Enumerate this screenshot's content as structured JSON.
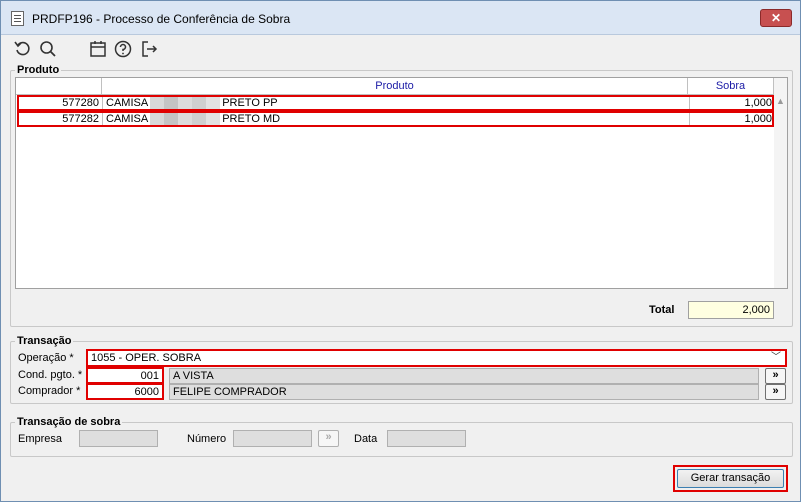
{
  "window": {
    "title": "PRDFP196 - Processo de Conferência de Sobra",
    "close_label": "✕"
  },
  "toolbar": {
    "icons": [
      "refresh-icon",
      "search-icon",
      "calendar-icon",
      "help-icon",
      "exit-icon"
    ]
  },
  "produto": {
    "group_title": "Produto",
    "columns": [
      "Produto",
      "Sobra"
    ],
    "rows": [
      {
        "code": "577280",
        "prod_start": "CAMISA",
        "prod_end": "PRETO PP",
        "sobra": "1,000"
      },
      {
        "code": "577282",
        "prod_start": "CAMISA",
        "prod_end": "PRETO MD",
        "sobra": "1,000"
      }
    ],
    "total_label": "Total",
    "total_value": "2,000"
  },
  "transacao": {
    "group_title": "Transação",
    "operacao_label": "Operação *",
    "operacao_value": "1055 - OPER. SOBRA",
    "cond_label": "Cond. pgto. *",
    "cond_code": "001",
    "cond_desc": "A VISTA",
    "comprador_label": "Comprador *",
    "comprador_code": "6000",
    "comprador_desc": "FELIPE COMPRADOR",
    "lookup_label": "»"
  },
  "transacao_sobra": {
    "group_title": "Transação de sobra",
    "empresa_label": "Empresa",
    "numero_label": "Número",
    "data_label": "Data"
  },
  "actions": {
    "gerar_label": "Gerar transação"
  },
  "colors": {
    "highlight": "#e00000",
    "header_text": "#1a1aa6",
    "total_bg": "#ffffe1"
  }
}
